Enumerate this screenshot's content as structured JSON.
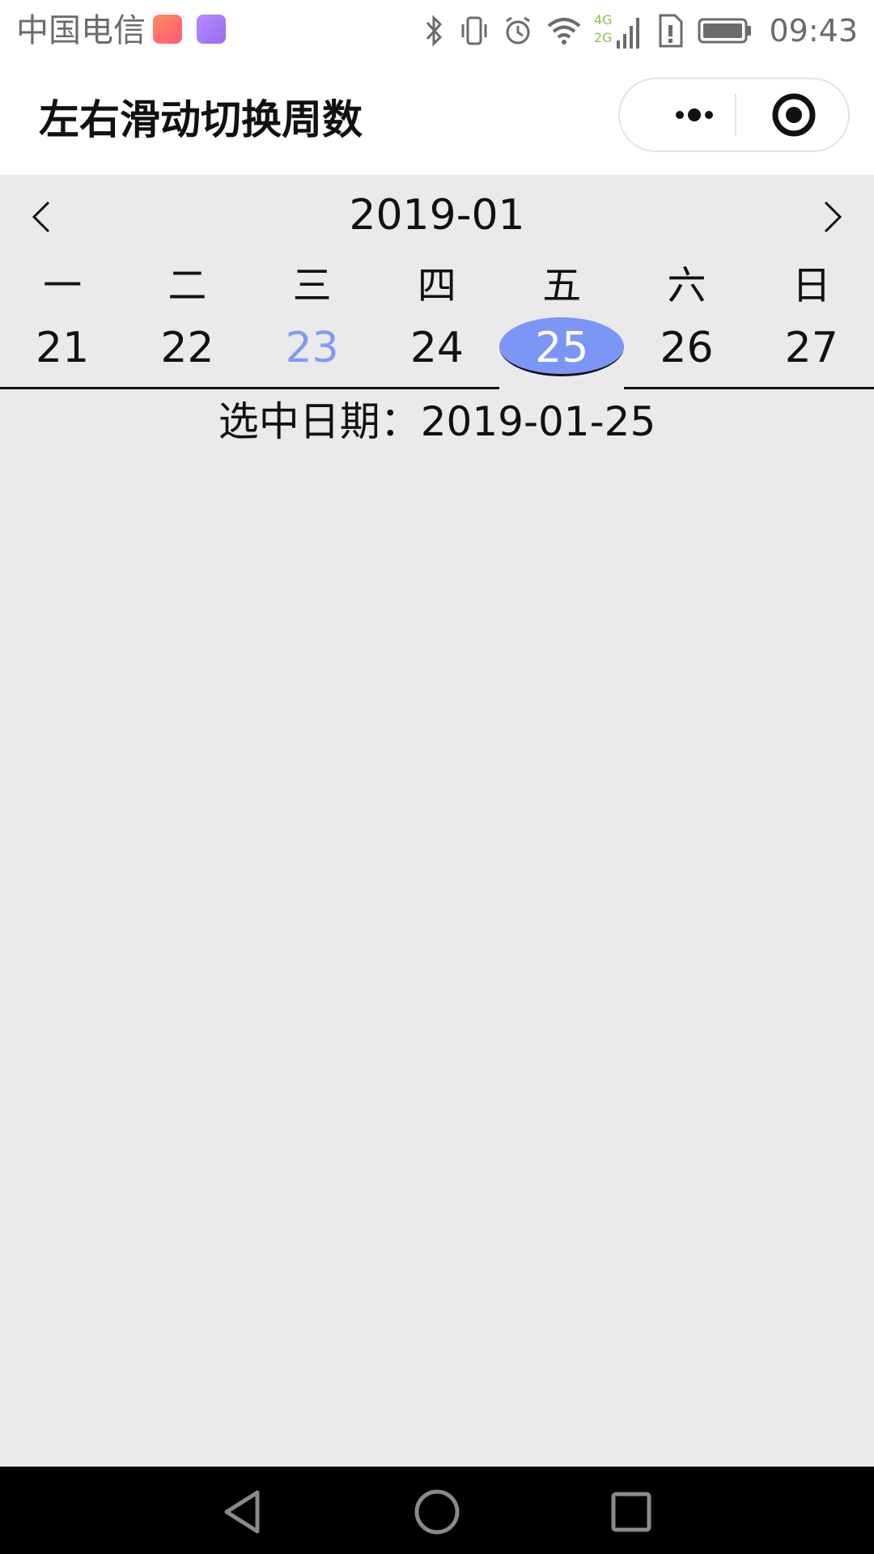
{
  "status_bar": {
    "carrier": "中国电信",
    "network_labels": [
      "4G",
      "2G"
    ],
    "time": "09:43"
  },
  "title_bar": {
    "title": "左右滑动切换周数"
  },
  "calendar": {
    "month": "2019-01",
    "weekdays": [
      "一",
      "二",
      "三",
      "四",
      "五",
      "六",
      "日"
    ],
    "dates": [
      "21",
      "22",
      "23",
      "24",
      "25",
      "26",
      "27"
    ],
    "today_index": 2,
    "selected_index": 4,
    "selected_label": "选中日期：2019-01-25"
  },
  "colors": {
    "accent": "#7b96f5",
    "today_text": "#7e9bf5",
    "background": "#eaeaea"
  },
  "icons": {
    "prev": "chevron-left-icon",
    "next": "chevron-right-icon",
    "more": "more-dots-icon",
    "close": "target-close-icon"
  }
}
